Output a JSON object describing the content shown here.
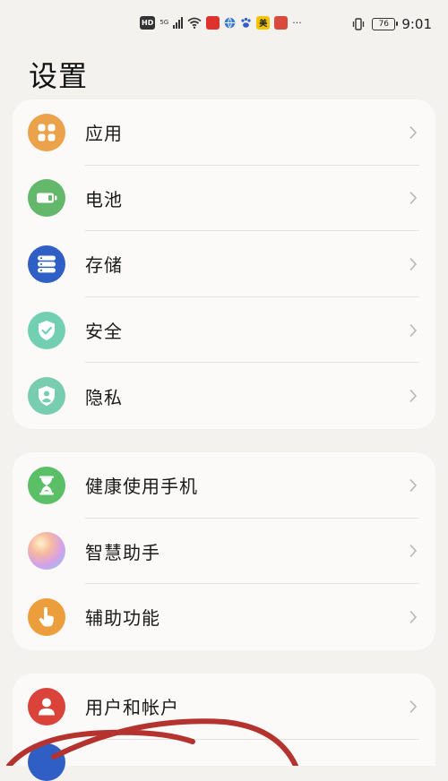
{
  "status_bar": {
    "left_badges": [
      "HD",
      "5G",
      "美"
    ],
    "battery": "76",
    "time": "9:01",
    "more": "···"
  },
  "page": {
    "title": "设置"
  },
  "groups": [
    {
      "items": [
        {
          "label": "应用",
          "icon": "apps-grid-icon",
          "color": "#eba24a"
        },
        {
          "label": "电池",
          "icon": "battery-icon",
          "color": "#63b86b"
        },
        {
          "label": "存储",
          "icon": "storage-icon",
          "color": "#2f5fc4"
        },
        {
          "label": "安全",
          "icon": "shield-check-icon",
          "color": "#73cfb2"
        },
        {
          "label": "隐私",
          "icon": "privacy-shield-icon",
          "color": "#78ccb0"
        }
      ]
    },
    {
      "items": [
        {
          "label": "健康使用手机",
          "icon": "hourglass-icon",
          "color": "#5bbf68"
        },
        {
          "label": "智慧助手",
          "icon": "smart-assistant-icon",
          "color": "#c9a8e8"
        },
        {
          "label": "辅助功能",
          "icon": "hand-touch-icon",
          "color": "#ec9d3c"
        }
      ]
    },
    {
      "items": [
        {
          "label": "用户和帐户",
          "icon": "user-icon",
          "color": "#d9433a"
        }
      ]
    }
  ],
  "colors": {
    "background": "#f4f2ef",
    "card": "#fbfaf8",
    "annotation_stroke": "#b5332f"
  }
}
